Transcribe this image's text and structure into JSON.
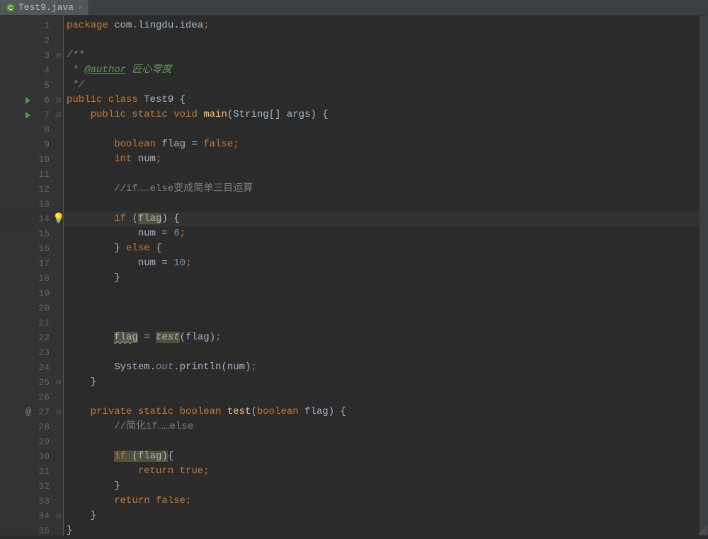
{
  "tab": {
    "filename": "Test9.java",
    "close": "×"
  },
  "lines": {
    "l1": {
      "n": "1"
    },
    "l2": {
      "n": "2"
    },
    "l3": {
      "n": "3"
    },
    "l4": {
      "n": "4"
    },
    "l5": {
      "n": "5"
    },
    "l6": {
      "n": "6"
    },
    "l7": {
      "n": "7"
    },
    "l8": {
      "n": "8"
    },
    "l9": {
      "n": "9"
    },
    "l10": {
      "n": "10"
    },
    "l11": {
      "n": "11"
    },
    "l12": {
      "n": "12"
    },
    "l13": {
      "n": "13"
    },
    "l14": {
      "n": "14"
    },
    "l15": {
      "n": "15"
    },
    "l16": {
      "n": "16"
    },
    "l17": {
      "n": "17"
    },
    "l18": {
      "n": "18"
    },
    "l19": {
      "n": "19"
    },
    "l20": {
      "n": "20"
    },
    "l21": {
      "n": "21"
    },
    "l22": {
      "n": "22"
    },
    "l23": {
      "n": "23"
    },
    "l24": {
      "n": "24"
    },
    "l25": {
      "n": "25"
    },
    "l26": {
      "n": "26"
    },
    "l27": {
      "n": "27"
    },
    "l28": {
      "n": "28"
    },
    "l29": {
      "n": "29"
    },
    "l30": {
      "n": "30"
    },
    "l31": {
      "n": "31"
    },
    "l32": {
      "n": "32"
    },
    "l33": {
      "n": "33"
    },
    "l34": {
      "n": "34"
    },
    "l35": {
      "n": "35"
    }
  },
  "code": {
    "pkg_kw": "package ",
    "pkg_name": "com.lingdu.idea",
    "semi": ";",
    "doc_open": "/**",
    "doc_star": " * ",
    "doc_author_tag": "@author",
    "doc_author_text": " 匠心零度",
    "doc_close": " */",
    "public_kw": "public ",
    "class_kw": "class ",
    "class_name": "Test9 ",
    "lbrace": "{",
    "rbrace": "}",
    "static_kw": "static ",
    "void_kw": "void ",
    "main_name": "main",
    "main_params": "(String[] args) ",
    "bool_kw": "boolean ",
    "flag_decl": "flag = ",
    "false_kw": "false",
    "int_kw": "int ",
    "num_decl": "num",
    "com1": "//if……else变成简单三目运算",
    "if_kw": "if ",
    "if_cond_open": "(",
    "flag_ref": "flag",
    "if_cond_close": ") ",
    "num_assign": "num = ",
    "val6": "6",
    "else_kw": " else ",
    "val10": "10",
    "flag_assign": " = ",
    "test_call": "test",
    "test_args_open": "(",
    "test_args_close": ")",
    "sys": "System.",
    "out": "out",
    "println": ".println(num)",
    "private_kw": "private ",
    "boolean_kw": "boolean ",
    "test_name": "test",
    "test_params": "(",
    "flag_param": "flag) ",
    "com2": "//简化if……else",
    "if2_cond": "(flag)",
    "return_kw": "return ",
    "true_kw": "true",
    "false_kw2": "false",
    "sp4": "    ",
    "sp8": "        ",
    "sp12": "            ",
    "sp16": "                "
  },
  "icons": {
    "bulb": "💡",
    "at": "@"
  }
}
